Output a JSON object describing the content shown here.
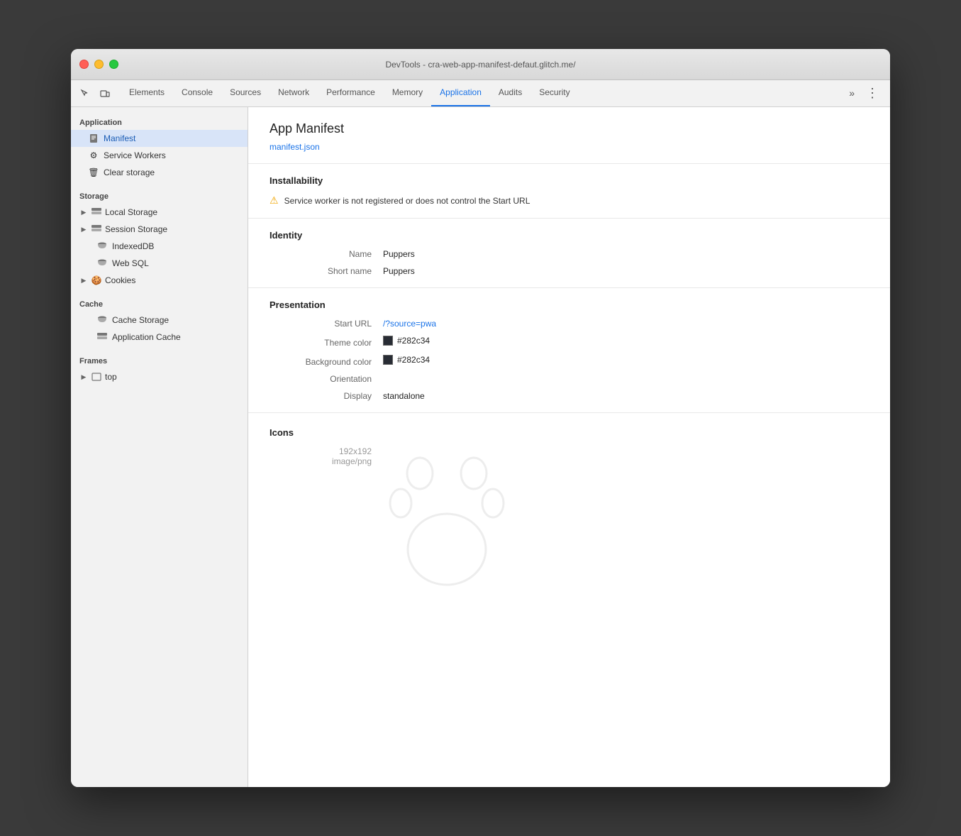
{
  "window": {
    "title": "DevTools - cra-web-app-manifest-defaut.glitch.me/"
  },
  "tabs": {
    "items": [
      {
        "label": "Elements",
        "active": false
      },
      {
        "label": "Console",
        "active": false
      },
      {
        "label": "Sources",
        "active": false
      },
      {
        "label": "Network",
        "active": false
      },
      {
        "label": "Performance",
        "active": false
      },
      {
        "label": "Memory",
        "active": false
      },
      {
        "label": "Application",
        "active": true
      },
      {
        "label": "Audits",
        "active": false
      },
      {
        "label": "Security",
        "active": false
      }
    ],
    "more_label": "»",
    "kebab_label": "⋮"
  },
  "sidebar": {
    "application_section": "Application",
    "manifest_label": "Manifest",
    "service_workers_label": "Service Workers",
    "clear_storage_label": "Clear storage",
    "storage_section": "Storage",
    "local_storage_label": "Local Storage",
    "session_storage_label": "Session Storage",
    "indexed_db_label": "IndexedDB",
    "web_sql_label": "Web SQL",
    "cookies_label": "Cookies",
    "cache_section": "Cache",
    "cache_storage_label": "Cache Storage",
    "application_cache_label": "Application Cache",
    "frames_section": "Frames",
    "top_label": "top"
  },
  "content": {
    "title": "App Manifest",
    "manifest_link": "manifest.json",
    "installability_heading": "Installability",
    "warning_text": "Service worker is not registered or does not control the Start URL",
    "identity_heading": "Identity",
    "name_label": "Name",
    "name_value": "Puppers",
    "short_name_label": "Short name",
    "short_name_value": "Puppers",
    "presentation_heading": "Presentation",
    "start_url_label": "Start URL",
    "start_url_value": "/?source=pwa",
    "theme_color_label": "Theme color",
    "theme_color_value": "#282c34",
    "background_color_label": "Background color",
    "background_color_value": "#282c34",
    "orientation_label": "Orientation",
    "orientation_value": "",
    "display_label": "Display",
    "display_value": "standalone",
    "icons_heading": "Icons",
    "icon_size": "192x192",
    "icon_type": "image/png"
  }
}
